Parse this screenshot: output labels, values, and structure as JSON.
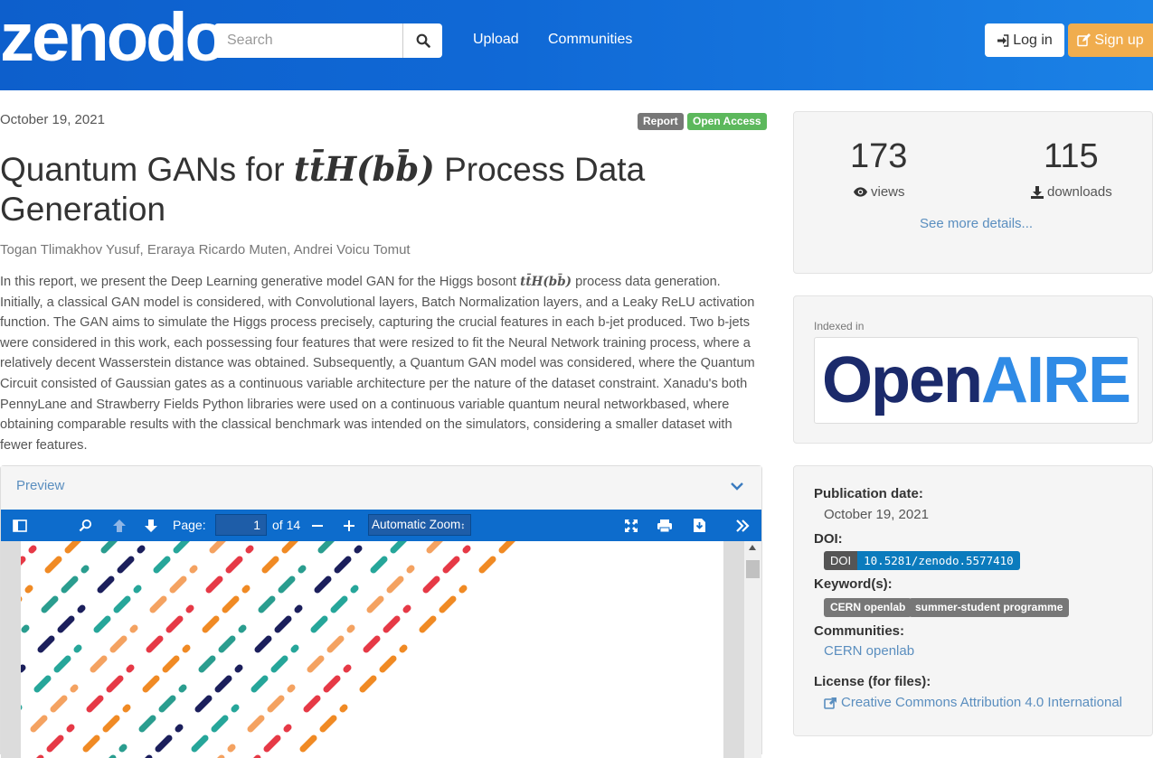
{
  "header": {
    "logo": "zenodo",
    "search_placeholder": "Search",
    "nav": {
      "upload": "Upload",
      "communities": "Communities"
    },
    "login_label": "Log in",
    "signup_label": "Sign up",
    "colors": {
      "bar": "#1069d6",
      "signup": "#f0ad4e"
    }
  },
  "record": {
    "date": "October 19, 2021",
    "labels": {
      "type": "Report",
      "access": "Open Access"
    },
    "title_pre": "Quantum GANs for ",
    "title_math": "tt̄H(bb̄)",
    "title_post": " Process Data Generation",
    "authors": "Togan Tlimakhov Yusuf, Eraraya Ricardo Muten, Andrei Voicu Tomut",
    "abstract_pre": "In this report, we present the Deep Learning generative model GAN for the Higgs bosont ",
    "abstract_math": "tt̄H(bb̄)",
    "abstract_post": " process data generation. Initially, a classical GAN model is considered, with Convolutional layers, Batch Normalization layers, and a Leaky ReLU activation function. The GAN aims to simulate the Higgs process precisely, capturing the crucial features in each b-jet produced. Two b-jets were considered in this work, each possessing four features that were resized to fit the Neural Network training process, where a relatively decent Wasserstein distance was obtained. Subsequently, a Quantum GAN model was considered, where the Quantum Circuit consisted of Gaussian gates as a continuous variable architecture per the nature of the dataset constraint. Xanadu's both PennyLane and Strawberry Fields Python libraries were used on a continuous variable quantum neural networkbased, where obtaining comparable results with the classical benchmark was intended on the simulators, considering a smaller dataset with fewer features."
  },
  "preview": {
    "title": "Preview",
    "page_label": "Page:",
    "page_current": "1",
    "page_total": "of 14",
    "zoom": "Automatic Zoom",
    "stripe_colors": [
      "#e63946",
      "#f08a24",
      "#2a9d8f",
      "#1b1f5c",
      "#26a69a",
      "#f4a261"
    ]
  },
  "stats": {
    "views": "173",
    "views_label": "views",
    "downloads": "115",
    "downloads_label": "downloads",
    "see_more": "See more details..."
  },
  "indexed": {
    "label": "Indexed in",
    "logo_part1": "Open",
    "logo_part2": "AIRE"
  },
  "meta": {
    "pub_date_label": "Publication date:",
    "pub_date": "October 19, 2021",
    "doi_label": "DOI:",
    "doi_badge": "DOI",
    "doi": "10.5281/zenodo.5577410",
    "keywords_label": "Keyword(s):",
    "keywords": [
      "CERN openlab",
      "summer-student programme"
    ],
    "communities_label": "Communities:",
    "community": "CERN openlab",
    "license_label": "License (for files):",
    "license": "Creative Commons Attribution 4.0 International"
  }
}
